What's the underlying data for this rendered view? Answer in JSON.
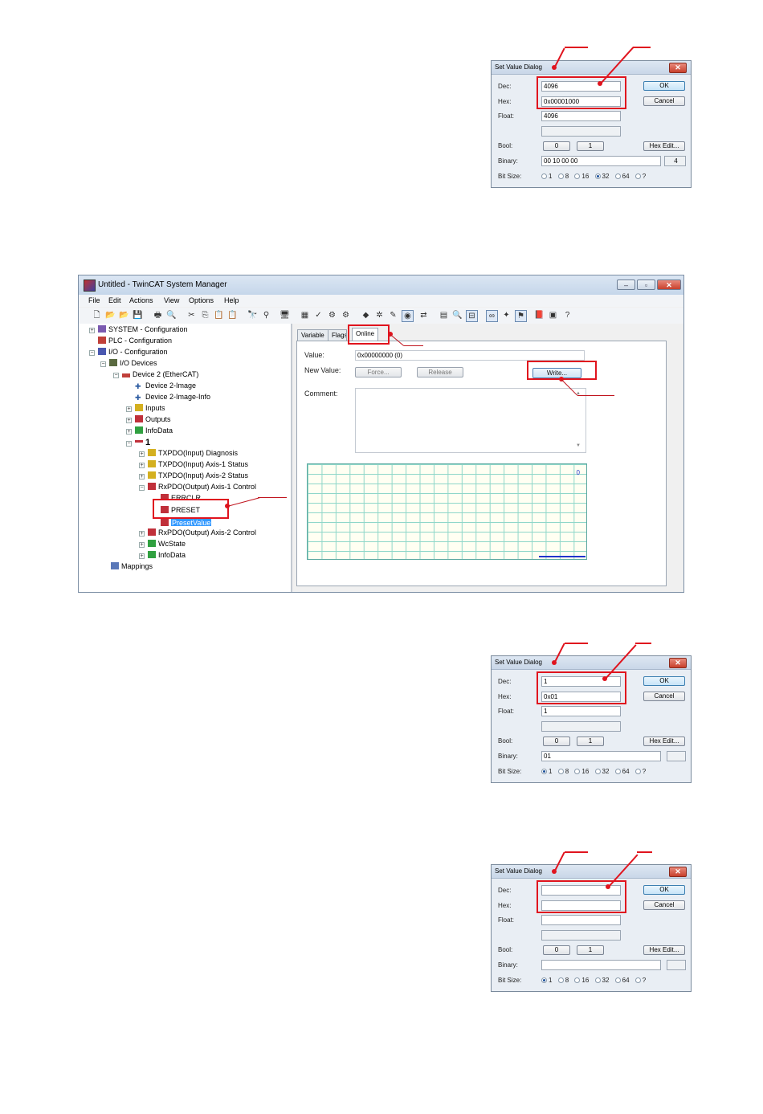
{
  "dialog": {
    "title": "Set Value Dialog",
    "close_symbol": "✕",
    "labels": {
      "dec": "Dec:",
      "hex": "Hex:",
      "float": "Float:",
      "bool": "Bool:",
      "binary": "Binary:",
      "bit_size": "Bit Size:"
    },
    "buttons": {
      "ok": "OK",
      "cancel": "Cancel",
      "bool_0": "0",
      "bool_1": "1",
      "hex_edit": "Hex Edit..."
    },
    "bit_size_options": [
      "1",
      "8",
      "16",
      "32",
      "64",
      "?"
    ]
  },
  "dialog1": {
    "dec": "4096",
    "hex": "0x00001000",
    "float": "4096",
    "binary": "00 10 00 00",
    "binary_bytes": "4",
    "bit_size": "32"
  },
  "dialog2": {
    "dec": "1",
    "hex": "0x01",
    "float": "1",
    "binary": "01",
    "binary_bytes": "",
    "bit_size": "1"
  },
  "dialog3": {
    "dec": "",
    "hex": "",
    "float": "",
    "binary": "",
    "binary_bytes": "",
    "bit_size": "1"
  },
  "window": {
    "title": "Untitled - TwinCAT System Manager",
    "controls": {
      "minimize": "–",
      "maximize": "▫",
      "close": "✕"
    },
    "menu": [
      "File",
      "Edit",
      "Actions",
      "View",
      "Options",
      "Help"
    ],
    "tree": {
      "system": "SYSTEM - Configuration",
      "plc": "PLC - Configuration",
      "io": "I/O - Configuration",
      "io_devices": "I/O Devices",
      "device2": "Device 2 (EtherCAT)",
      "image": "Device 2-Image",
      "image_info": "Device 2-Image-Info",
      "inputs": "Inputs",
      "outputs": "Outputs",
      "infodata": "InfoData",
      "slave": "1",
      "txpdo_diag": "TXPDO(Input) Diagnosis",
      "txpdo_axis1": "TXPDO(Input) Axis-1 Status",
      "txpdo_axis2": "TXPDO(Input) Axis-2 Status",
      "rxpdo_axis1": "RxPDO(Output) Axis-1 Control",
      "errclr": "ERRCLR",
      "preset": "PRESET",
      "preset_value": "PresetValue",
      "rxpdo_axis2": "RxPDO(Output) Axis-2 Control",
      "wcstate": "WcState",
      "infodata2": "InfoData",
      "mappings": "Mappings"
    },
    "tabs": [
      "Variable",
      "Flags",
      "Online"
    ],
    "online": {
      "value_label": "Value:",
      "value": "0x00000000 (0)",
      "new_value_label": "New Value:",
      "force": "Force...",
      "release": "Release",
      "write": "Write...",
      "comment_label": "Comment:",
      "chart_y": "0"
    }
  }
}
